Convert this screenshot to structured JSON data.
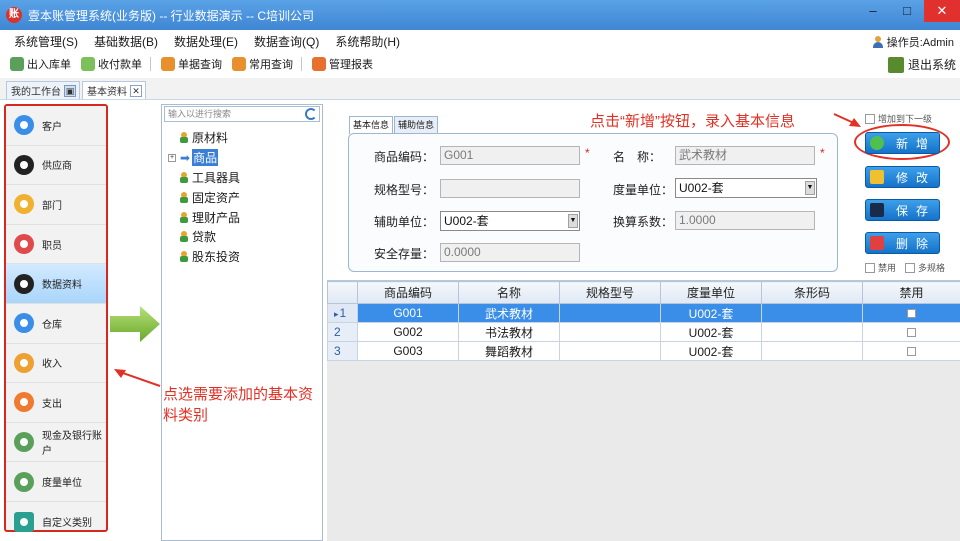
{
  "window": {
    "title": "壹本账管理系统(业务版) -- 行业数据演示 -- C培训公司",
    "app_icon_glyph": "账",
    "controls": {
      "minimize": "–",
      "maximize": "□",
      "close": "✕"
    }
  },
  "menubar": {
    "items": [
      "系统管理(S)",
      "基础数据(B)",
      "数据处理(E)",
      "数据查询(Q)",
      "系统帮助(H)"
    ],
    "operator": "操作员:Admin"
  },
  "toolbar": {
    "items": [
      {
        "label": "出入库单",
        "icon": "warehouse-icon",
        "color": "#5aa05a"
      },
      {
        "label": "收付款单",
        "icon": "payment-icon",
        "color": "#7cc05a"
      },
      {
        "label": "单据查询",
        "icon": "document-search-icon",
        "color": "#e8902e"
      },
      {
        "label": "常用查询",
        "icon": "chart-icon",
        "color": "#e8902e"
      },
      {
        "label": "管理报表",
        "icon": "report-icon",
        "color": "#e86f2e"
      }
    ],
    "exit": "退出系统"
  },
  "tabs": [
    {
      "label": "我的工作台",
      "active": false
    },
    {
      "label": "基本资料",
      "active": true
    }
  ],
  "categories": [
    {
      "label": "客户",
      "icon": "customer-icon",
      "color": "#3a8ee8"
    },
    {
      "label": "供应商",
      "icon": "supplier-icon",
      "color": "#222222"
    },
    {
      "label": "部门",
      "icon": "department-icon",
      "color": "#f0b030"
    },
    {
      "label": "职员",
      "icon": "employee-icon",
      "color": "#e04a4a"
    },
    {
      "label": "数据资料",
      "icon": "data-icon",
      "color": "#222222",
      "active": true
    },
    {
      "label": "仓库",
      "icon": "warehouse-icon",
      "color": "#3a8ee8"
    },
    {
      "label": "收入",
      "icon": "income-icon",
      "color": "#f0a030"
    },
    {
      "label": "支出",
      "icon": "expense-icon",
      "color": "#f07a30"
    },
    {
      "label": "现金及银行账户",
      "icon": "bank-icon",
      "color": "#5aa05a"
    },
    {
      "label": "度量单位",
      "icon": "unit-icon",
      "color": "#5aa05a"
    },
    {
      "label": "自定义类别",
      "icon": "custom-category-icon",
      "color": "#2aa090"
    }
  ],
  "tree": {
    "search_placeholder": "输入以进行搜索",
    "nodes": [
      {
        "label": "原材料",
        "selected": false
      },
      {
        "label": "商品",
        "selected": true
      },
      {
        "label": "工具器具",
        "selected": false
      },
      {
        "label": "固定资产",
        "selected": false
      },
      {
        "label": "理财产品",
        "selected": false
      },
      {
        "label": "贷款",
        "selected": false
      },
      {
        "label": "股东投资",
        "selected": false
      }
    ]
  },
  "form": {
    "subtabs": [
      "基本信息",
      "辅助信息"
    ],
    "code_label": "商品编码：",
    "code_value": "G001",
    "name_label": "名　称：",
    "name_value": "武术教材",
    "spec_label": "规格型号：",
    "spec_value": "",
    "unit_label": "度量单位：",
    "unit_value": "U002-套",
    "aux_unit_label": "辅助单位：",
    "aux_unit_value": "U002-套",
    "ratio_label": "换算系数：",
    "ratio_value": "1.0000",
    "safety_label": "安全存量：",
    "safety_value": "0.0000",
    "required_mark": "*"
  },
  "annotations": {
    "top": "点击“新增”按钮，录入基本信息",
    "left": "点选需要添加的基本资料类别"
  },
  "actions": {
    "add_to_next_level": "增加到下一级",
    "add": "新增",
    "edit": "修改",
    "save": "保存",
    "delete": "删除",
    "disabled": "禁用",
    "multi_spec": "多规格"
  },
  "grid": {
    "columns": [
      "",
      "商品编码",
      "名称",
      "规格型号",
      "度量单位",
      "条形码",
      "禁用"
    ],
    "rows": [
      {
        "num": "1",
        "code": "G001",
        "name": "武术教材",
        "spec": "",
        "unit": "U002-套",
        "barcode": "",
        "selected": true
      },
      {
        "num": "2",
        "code": "G002",
        "name": "书法教材",
        "spec": "",
        "unit": "U002-套",
        "barcode": "",
        "selected": false
      },
      {
        "num": "3",
        "code": "G003",
        "name": "舞蹈教材",
        "spec": "",
        "unit": "U002-套",
        "barcode": "",
        "selected": false
      }
    ]
  },
  "colors": {
    "accent": "#3a8ee8",
    "annotation": "#e23124",
    "titlebar": "#4a95dd"
  }
}
